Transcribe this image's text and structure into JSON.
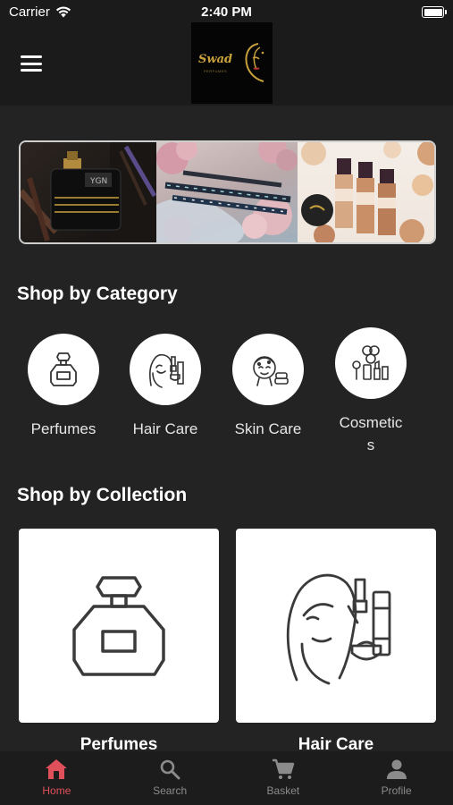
{
  "status_bar": {
    "carrier": "Carrier",
    "time": "2:40 PM"
  },
  "header": {
    "logo_text": "Swad",
    "logo_subtext": "PERFUMES"
  },
  "sections": {
    "categories_title": "Shop by Category",
    "collections_title": "Shop by Collection"
  },
  "categories": [
    {
      "label": "Perfumes",
      "icon": "perfume-bottle-icon"
    },
    {
      "label": "Hair Care",
      "icon": "hair-care-icon"
    },
    {
      "label": "Skin Care",
      "icon": "skin-care-icon"
    },
    {
      "label": "Cosmetics",
      "line1": "Cosmetic",
      "line2": "s",
      "icon": "cosmetics-icon"
    }
  ],
  "collections": [
    {
      "label": "Perfumes",
      "icon": "perfume-bottle-icon"
    },
    {
      "label": "Hair Care",
      "icon": "hair-care-icon"
    }
  ],
  "tabs": [
    {
      "label": "Home",
      "icon": "home-icon",
      "active": true
    },
    {
      "label": "Search",
      "icon": "search-icon",
      "active": false
    },
    {
      "label": "Basket",
      "icon": "cart-icon",
      "active": false
    },
    {
      "label": "Profile",
      "icon": "profile-icon",
      "active": false
    }
  ],
  "colors": {
    "background": "#232323",
    "header": "#1b1b1b",
    "accent": "#e0505a",
    "inactive_tab": "#8b8b8b",
    "logo_gold": "#c9a23c"
  }
}
